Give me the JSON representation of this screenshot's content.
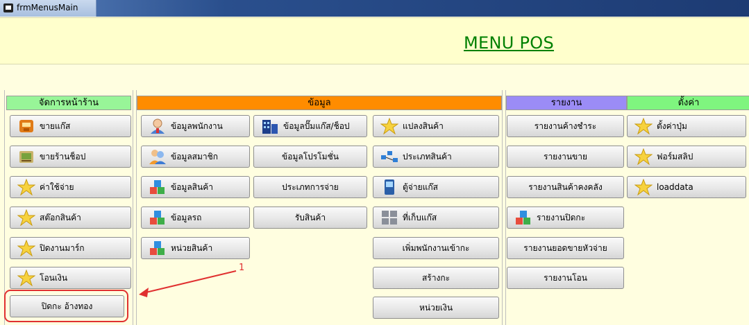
{
  "window": {
    "title": "frmMenusMain"
  },
  "header": {
    "title": "MENU POS"
  },
  "sections": {
    "front": {
      "label": "จัดการหน้าร้าน",
      "color": "#98f598"
    },
    "data": {
      "label": "ข้อมูล",
      "color": "#ff8c00"
    },
    "report": {
      "label": "รายงาน",
      "color": "#9b8cf6"
    },
    "settings": {
      "label": "ตั้งค่า",
      "color": "#7ff57f"
    }
  },
  "front_buttons": [
    "ขายแก๊ส",
    "ขายร้านช็อป",
    "ค่าใช้จ่าย",
    "สต๊อกสินค้า",
    "ปิดงานมาร์ก",
    "โอนเงิน",
    "ปิดกะ อ้างทอง"
  ],
  "data_col1": [
    "ข้อมูลพนักงาน",
    "ข้อมูลสมาชิก",
    "ข้อมูลสินค้า",
    "ข้อมูลรถ",
    "หน่วยสินค้า"
  ],
  "data_col2": [
    "ข้อมูลปั๊มแก๊ส/ช็อป",
    "ข้อมูลโปรโมชั่น",
    "ประเภทการจ่าย",
    "รับสินค้า"
  ],
  "data_col3": [
    "แปลงสินค้า",
    "ประเภทสินค้า",
    "ตู้จ่ายแก๊ส",
    "ที่เก็บแก๊ส",
    "เพิ่มพนักงานเข้ากะ",
    "สร้างกะ",
    "หน่วยเงิน"
  ],
  "report_buttons": [
    "รายงานค้างชำระ",
    "รายงานขาย",
    "รายงานสินค้าคงคลัง",
    "รายงานปิดกะ",
    "รายงานยอดขายหัวจ่าย",
    "รายงานโอน"
  ],
  "settings_buttons": [
    "ตั้งค่าปุ่ม",
    "ฟอร์มสลิป",
    "loaddata"
  ],
  "annotation": {
    "number": "1",
    "color": "#e03030"
  }
}
